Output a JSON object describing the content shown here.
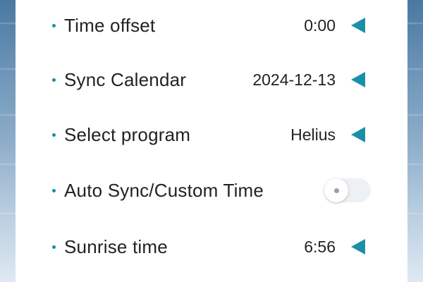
{
  "settings": {
    "rows": [
      {
        "label": "Time offset",
        "value": "0:00",
        "control": "arrow"
      },
      {
        "label": "Sync Calendar",
        "value": "2024-12-13",
        "control": "arrow"
      },
      {
        "label": "Select program",
        "value": "Helius",
        "control": "arrow"
      },
      {
        "label": "Auto Sync/Custom Time",
        "value": "",
        "control": "toggle",
        "toggle_on": false
      },
      {
        "label": "Sunrise time",
        "value": "6:56",
        "control": "arrow"
      }
    ]
  },
  "colors": {
    "accent": "#1a8fa8",
    "text": "#222222",
    "panel": "#ffffff"
  },
  "icons": {
    "row_arrow": "triangle-left-icon",
    "bullet": "bullet-icon"
  }
}
